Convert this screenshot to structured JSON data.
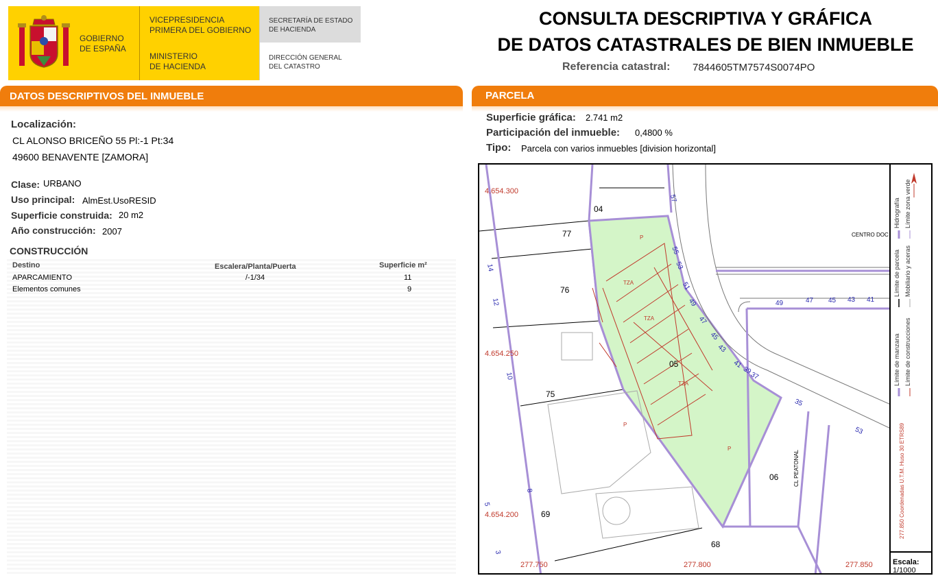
{
  "header": {
    "gov_line": "GOBIERNO\nDE ESPAÑA",
    "vice_line": "VICEPRESIDENCIA\nPRIMERA DEL GOBIERNO",
    "ministry_line": "MINISTERIO\nDE HACIENDA",
    "secretaria_line": "SECRETARÍA DE ESTADO\nDE HACIENDA",
    "direccion_line": "DIRECCIÓN GENERAL\nDEL CATASTRO",
    "brand_yellow": "#ffd100",
    "title": "CONSULTA DESCRIPTIVA Y GRÁFICA\nDE DATOS CATASTRALES DE BIEN INMUEBLE",
    "ref_label": "Referencia catastral:",
    "ref_value": "7844605TM7574S0074PO"
  },
  "left_section": {
    "bar_title": "DATOS DESCRIPTIVOS DEL INMUEBLE",
    "accent": "#f07d0c",
    "localizacion_label": "Localización:",
    "address_line1": "CL ALONSO BRICEÑO 55 Pl:-1 Pt:34",
    "address_line2": "49600 BENAVENTE [ZAMORA]",
    "clase_label": "Clase:",
    "clase_value": "URBANO",
    "uso_label": "Uso principal:",
    "uso_value": "AlmEst.UsoRESID",
    "superficie_label": "Superficie construida:",
    "superficie_value": "20 m2",
    "anio_label": "Año construcción:",
    "anio_value": "2007",
    "construccion_title": "CONSTRUCCIÓN",
    "table": {
      "headers": [
        "Destino",
        "Escalera/Planta/Puerta",
        "Superficie m²"
      ],
      "rows": [
        {
          "destino": "APARCAMIENTO",
          "planta": "/-1/34",
          "superficie": "11"
        },
        {
          "destino": "Elementos comunes",
          "planta": "",
          "superficie": "9"
        }
      ]
    }
  },
  "right_section": {
    "bar_title": "PARCELA",
    "superficie_label": "Superficie gráfica:",
    "superficie_value": "2.741 m2",
    "participacion_label": "Participación del inmueble:",
    "participacion_value": "0,4800 %",
    "tipo_label": "Tipo:",
    "tipo_value": "Parcela con varios inmuebles [division horizontal]"
  },
  "map": {
    "coord_y_top": "4.654.300",
    "coord_y_mid": "4.654.250",
    "coord_y_bottom": "4.654.200",
    "coord_x_left": "277.750",
    "coord_x_mid": "277.800",
    "coord_x_right": "277.850",
    "parcel_labels": [
      "04",
      "77",
      "76",
      "75",
      "69",
      "68",
      "06",
      "05"
    ],
    "street_numbers": [
      "57",
      "55",
      "53",
      "51",
      "49",
      "47",
      "45",
      "43",
      "41",
      "39",
      "37",
      "35",
      "53"
    ],
    "block_numbers": [
      "49",
      "47",
      "45",
      "43",
      "41"
    ],
    "left_numbers": [
      "14",
      "12",
      "10",
      "8",
      "6",
      "5",
      "3"
    ],
    "centro_label": "CENTRO DOC",
    "peatonal_label": "CL PEATONAL",
    "p_label": "P",
    "tza_label": "TZA",
    "parcel_fill": "#d4f5c8",
    "parcel_border": "#a78fd6",
    "construction_color": "#c0392b"
  },
  "legend": {
    "items": [
      "Hidrografía",
      "Límite zona verde",
      "Límite de parcela",
      "Mobiliario y aceras",
      "Límite de manzana",
      "Límite de construcciones"
    ],
    "coords_note": "277.850 Coordenadas U.T.M. Huso 30 ETRS89",
    "scale_label": "Escala:",
    "scale_value": "1/1000"
  }
}
